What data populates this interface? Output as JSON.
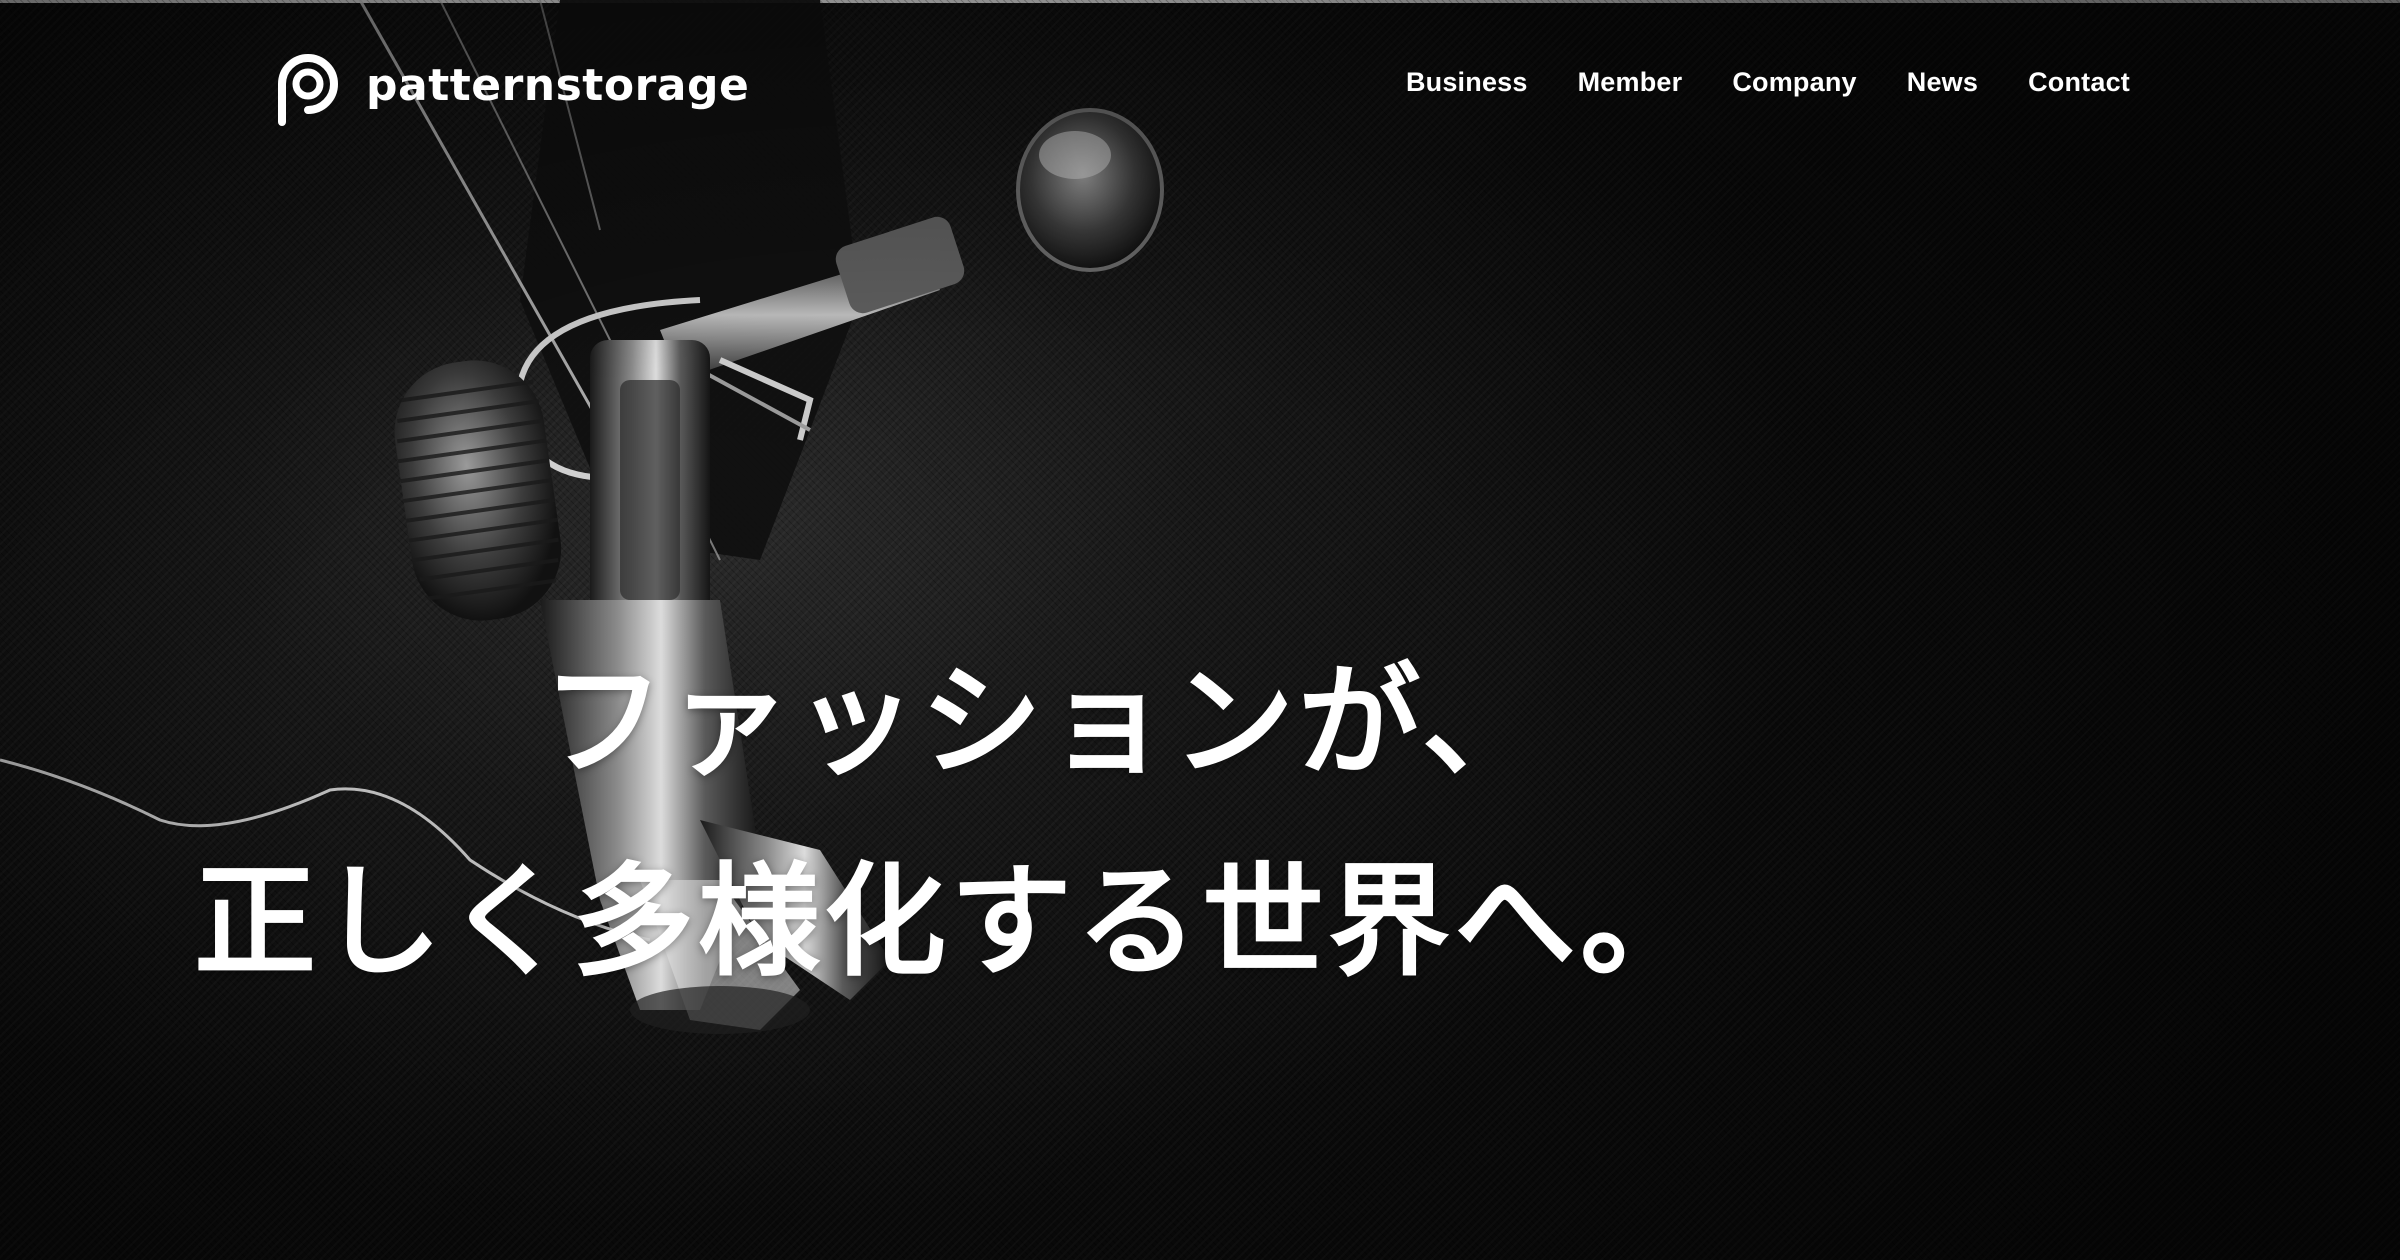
{
  "brand": {
    "name": "patternstorage",
    "logo_icon": "p-circle-logo-icon"
  },
  "nav": {
    "items": [
      {
        "label": "Business"
      },
      {
        "label": "Member"
      },
      {
        "label": "Company"
      },
      {
        "label": "News"
      },
      {
        "label": "Contact"
      }
    ]
  },
  "hero": {
    "line1": "ファッションが、",
    "line2": "正しく多様化する世界へ。",
    "image": "sewing-machine-presser-foot-photo"
  },
  "colors": {
    "text": "#ffffff",
    "background": "#0a0a0a"
  }
}
